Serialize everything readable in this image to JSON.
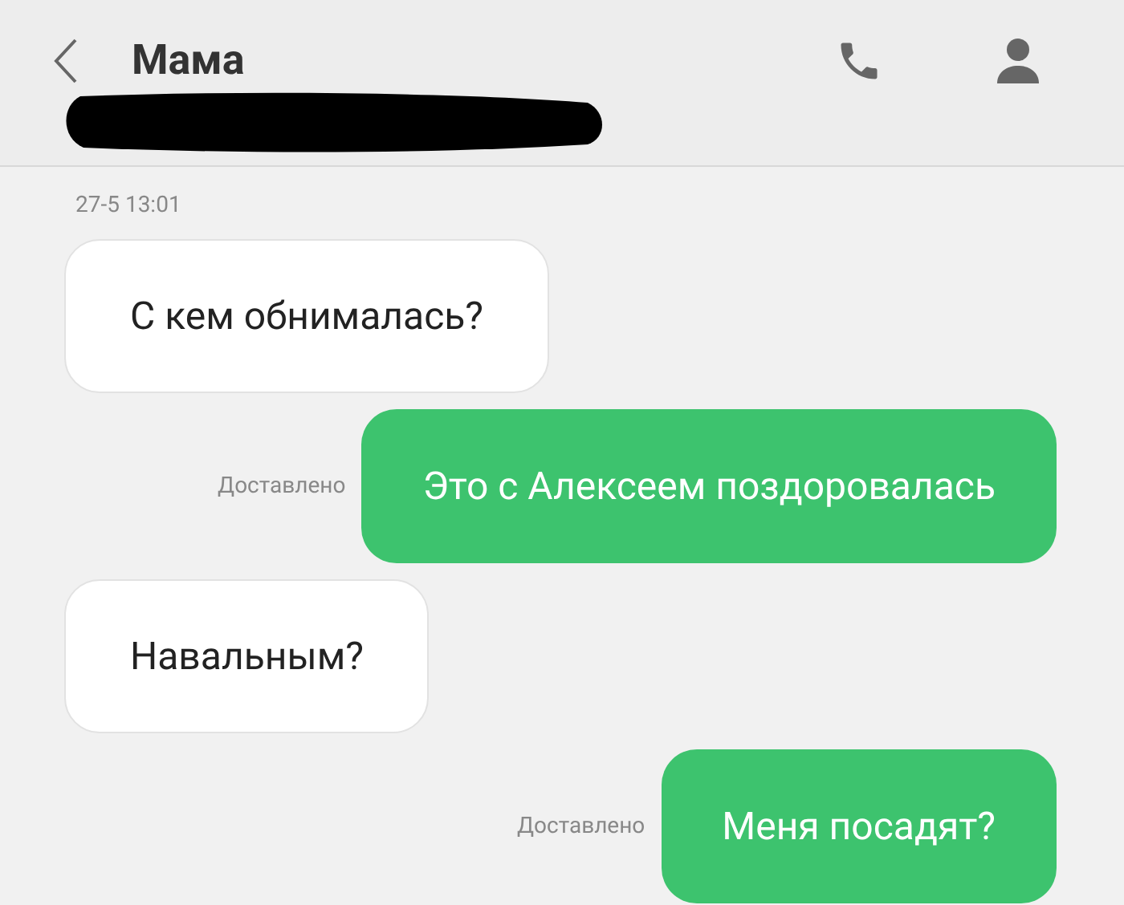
{
  "header": {
    "title": "Мама",
    "subtitle_redacted": true
  },
  "timestamp": "27-5 13:01",
  "messages": [
    {
      "kind": "incoming",
      "text": "С кем обнималась?"
    },
    {
      "kind": "outgoing",
      "text": "Это с Алексеем поздоровалась",
      "status": "Доставлено"
    },
    {
      "kind": "incoming",
      "text": "Навальным?"
    },
    {
      "kind": "outgoing",
      "text": "Меня посадят?",
      "status": "Доставлено"
    }
  ]
}
